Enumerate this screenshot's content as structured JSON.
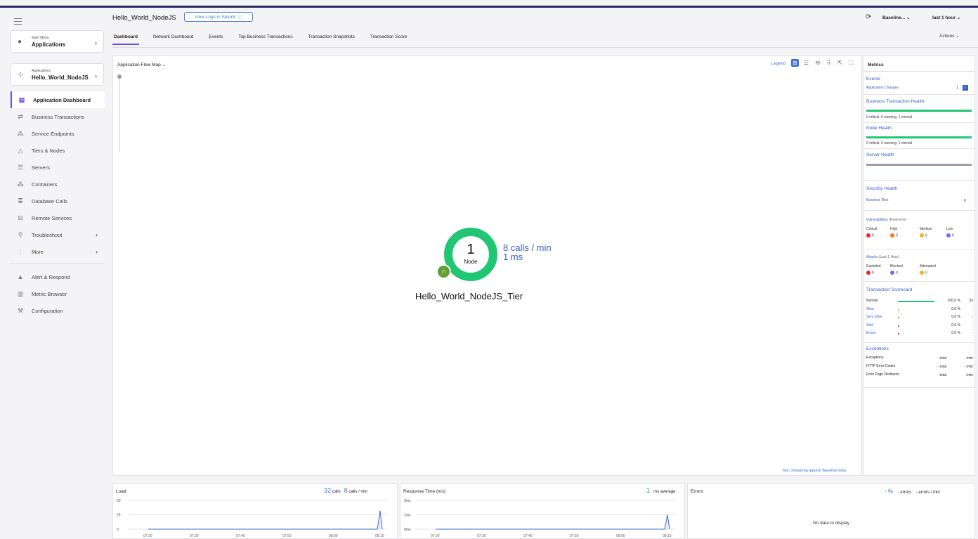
{
  "app": {
    "title": "Hello_World_NodeJS",
    "splunk_button": "View Logs in Splunk"
  },
  "header": {
    "baseline": "Baseline...",
    "time_range": "last 1 hour",
    "actions": "Actions",
    "tabs": [
      "Dashboard",
      "Network Dashboard",
      "Events",
      "Top Business Transactions",
      "Transaction Snapshots",
      "Transaction Score"
    ]
  },
  "sidebar": {
    "main_menu": {
      "small": "Main Menu",
      "big": "Applications"
    },
    "app_menu": {
      "small": "Applications",
      "big": "Hello_World_NodeJS"
    },
    "items": [
      {
        "label": "Application Dashboard"
      },
      {
        "label": "Business Transactions"
      },
      {
        "label": "Service Endpoints"
      },
      {
        "label": "Tiers & Nodes"
      },
      {
        "label": "Servers"
      },
      {
        "label": "Containers"
      },
      {
        "label": "Database Calls"
      },
      {
        "label": "Remote Services"
      },
      {
        "label": "Troubleshoot"
      },
      {
        "label": "More"
      },
      {
        "label": "Alert & Respond"
      },
      {
        "label": "Metric Browser"
      },
      {
        "label": "Configuration"
      }
    ]
  },
  "flowmap": {
    "title": "Application Flow Map",
    "legend": "Legend",
    "node_count": "1",
    "node_label": "Node",
    "calls_per_min": "8 calls / min",
    "response": "1 ms",
    "tier_name": "Hello_World_NodeJS_Tier",
    "baseline_note": "Not comparing against Baseline data"
  },
  "metrics": {
    "title": "Metrics",
    "events": {
      "title": "Events",
      "app_changes_label": "Application Changes",
      "app_changes_count": "1"
    },
    "bt_health": {
      "title": "Business Transaction Health",
      "summary": "0 critical, 0 warning, 1 normal"
    },
    "node_health": {
      "title": "Node Health",
      "summary": "0 critical, 0 warning, 1 normal"
    },
    "server_health": {
      "title": "Server Health"
    },
    "security": {
      "title": "Security Health",
      "risk_label": "Business Risk",
      "risk_value": "0",
      "vuln_label": "Vulnerabilities",
      "vuln_sub": "(Real-time)",
      "vuln": [
        {
          "label": "Critical",
          "value": "0",
          "color": "#e8282b"
        },
        {
          "label": "High",
          "value": "0",
          "color": "#f07c1e"
        },
        {
          "label": "Medium",
          "value": "0",
          "color": "#f2b51b"
        },
        {
          "label": "Low",
          "value": "0",
          "color": "#7b68ee"
        }
      ],
      "attacks_label": "Attacks",
      "attacks_sub": "(Last 1 Hour)",
      "attacks": [
        {
          "label": "Exploited",
          "value": "0",
          "color": "#e8282b"
        },
        {
          "label": "Blocked",
          "value": "0",
          "color": "#7b68ee"
        },
        {
          "label": "Attempted",
          "value": "0",
          "color": "#f2b51b"
        }
      ]
    },
    "scorecard": {
      "title": "Transaction Scorecard",
      "rows": [
        {
          "label": "Normal",
          "pct": "100.0 %",
          "count": "32",
          "fraction": 1.0,
          "color": "#1fc774"
        },
        {
          "label": "Slow",
          "pct": "0.0 %",
          "count": "-",
          "fraction": 0.0,
          "color": "#f2b51b"
        },
        {
          "label": "Very Slow",
          "pct": "0.0 %",
          "count": "-",
          "fraction": 0.0,
          "color": "#f07c1e"
        },
        {
          "label": "Stall",
          "pct": "0.0 %",
          "count": "-",
          "fraction": 0.0,
          "color": "#e03b8a"
        },
        {
          "label": "Errors",
          "pct": "0.0 %",
          "count": "-",
          "fraction": 0.0,
          "color": "#e8282b"
        }
      ]
    },
    "exceptions": {
      "title": "Exceptions",
      "rows": [
        {
          "label": "Exceptions",
          "total": "- total",
          "rate": "- /min"
        },
        {
          "label": "HTTP Error Codes",
          "total": "- total",
          "rate": "- /min"
        },
        {
          "label": "Error Page Redirects",
          "total": "- total",
          "rate": "- /min"
        }
      ]
    }
  },
  "charts": {
    "load": {
      "title": "Load",
      "calls": "32",
      "calls_unit": "calls",
      "rate": "8",
      "rate_unit": "calls / min",
      "yticks": [
        "50",
        "25",
        "0"
      ]
    },
    "response": {
      "title": "Response Time (ms)",
      "avg": "1",
      "avg_unit": "ms average",
      "yticks": [
        "2ms",
        "1ms",
        "0ms"
      ]
    },
    "errors": {
      "title": "Errors",
      "pct": "- %",
      "errors": "- errors",
      "rate": "- errors / min",
      "nodata": "No data to display"
    },
    "xticks": [
      "07:20",
      "07:30",
      "07:40",
      "07:50",
      "08:00",
      "08:10"
    ]
  },
  "chart_data": [
    {
      "type": "line",
      "title": "Load",
      "x": [
        "07:20",
        "07:30",
        "07:40",
        "07:50",
        "08:00",
        "08:10"
      ],
      "series": [
        {
          "values": [
            0,
            0,
            0,
            0,
            0,
            32
          ]
        }
      ],
      "ylim": [
        0,
        50
      ]
    },
    {
      "type": "line",
      "title": "Response Time (ms)",
      "x": [
        "07:20",
        "07:30",
        "07:40",
        "07:50",
        "08:00",
        "08:10"
      ],
      "series": [
        {
          "values": [
            0,
            0,
            0,
            0,
            0,
            1
          ]
        }
      ],
      "ylim": [
        0,
        2
      ]
    }
  ]
}
